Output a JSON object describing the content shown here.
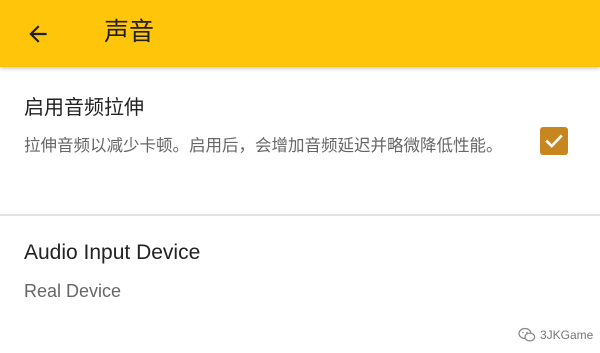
{
  "colors": {
    "app_bar": "#FFC50A",
    "checkbox": "#C8871E",
    "title_text": "#202020",
    "summary_text": "#666666",
    "divider": "#E3E3E3"
  },
  "header": {
    "back_icon": "arrow-left-icon",
    "title": "声音"
  },
  "settings": {
    "audio_stretch": {
      "title": "启用音频拉伸",
      "summary": "拉伸音频以减少卡顿。启用后，会增加音频延迟并略微降低性能。",
      "checked": true
    },
    "audio_input_device": {
      "title": "Audio Input Device",
      "value": "Real Device"
    }
  },
  "watermark": {
    "icon": "wechat-icon",
    "text": "3JKGame"
  }
}
